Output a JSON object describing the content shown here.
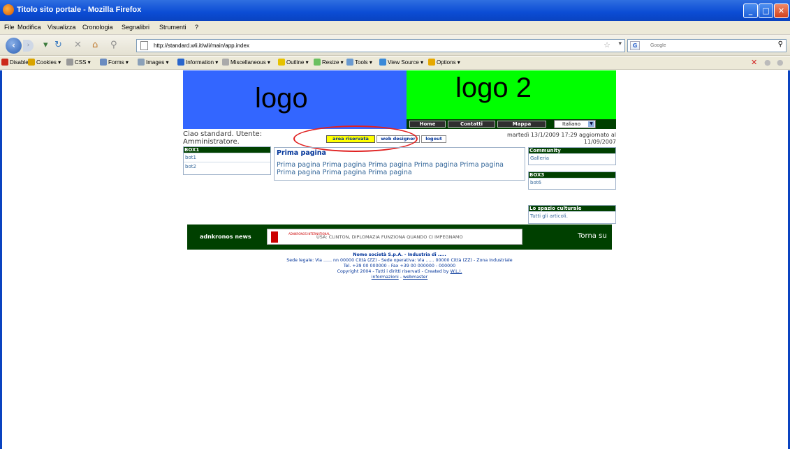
{
  "window": {
    "title": "Titolo sito portale - Mozilla Firefox"
  },
  "menu": [
    "File",
    "Modifica",
    "Visualizza",
    "Cronologia",
    "Segnalibri",
    "Strumenti",
    "?"
  ],
  "nav": {
    "url": "http://standard.wli.it/wli/main/app.index",
    "search_placeholder": "Google",
    "search_engine": "G"
  },
  "devbar": {
    "items": [
      "Disable",
      "Cookies",
      "CSS",
      "Forms",
      "Images",
      "Information",
      "Miscellaneous",
      "Outline",
      "Resize",
      "Tools",
      "View Source",
      "Options"
    ],
    "colors": [
      "#cc2a1a",
      "#d9a400",
      "#999999",
      "#6b8cc0",
      "#8aa0b8",
      "#2a66cc",
      "#aaaaaa",
      "#e6c200",
      "#6ac060",
      "#6a9ad0",
      "#3a8ad8",
      "#e6a800"
    ]
  },
  "page": {
    "logo1": "logo",
    "logo2": "logo 2",
    "nav_links": [
      "Home",
      "Contatti",
      "Mappa"
    ],
    "language": "Italiano",
    "greeting": "Ciao standard. Utente: Amministratore.",
    "buttons": [
      "area riservata",
      "web designer",
      "logout"
    ],
    "date": "martedì 13/1/2009 17:29 aggiornato al 11/09/2007",
    "box1": {
      "title": "BOX1",
      "items": [
        "bot1",
        "bot2"
      ]
    },
    "main": {
      "title": "Prima pagina",
      "text": "Prima pagina Prima pagina Prima pagina Prima pagina Prima pagina Prima pagina Prima pagina Prima pagina"
    },
    "community": {
      "title": "Community",
      "items": [
        "Galleria"
      ]
    },
    "box3": {
      "title": "BOX3",
      "items": [
        "bot6"
      ]
    },
    "culture": {
      "title": "Lo spazio culturale",
      "items": [
        "Tutti gli articoli."
      ]
    },
    "news": {
      "brand": "adnkronos news",
      "agency": "ADNKRONOS INTERNATIONAL",
      "headline": "USA: CLINTON, DIPLOMAZIA FUNZIONA QUANDO CI IMPEGNAMO",
      "right": "Torna su"
    },
    "footer": {
      "company": "Nome società S.p.A. - Industria di .....",
      "address": "Sede legale: Via ...... nn 00000 Città (ZZ) - Sede operativa: Via ...... 00000 Città (ZZ) - Zona Industriale",
      "phone": "Tel. +39 00 000000 - Fax +39 00 000000 - 000000",
      "copyright_prefix": "Copyright 2004 - Tutti i diritti riservati - Created by",
      "copyright_link": "W.L.I.",
      "info_link": "informazioni",
      "separator": " - ",
      "webmaster_link": "webmaster"
    }
  }
}
